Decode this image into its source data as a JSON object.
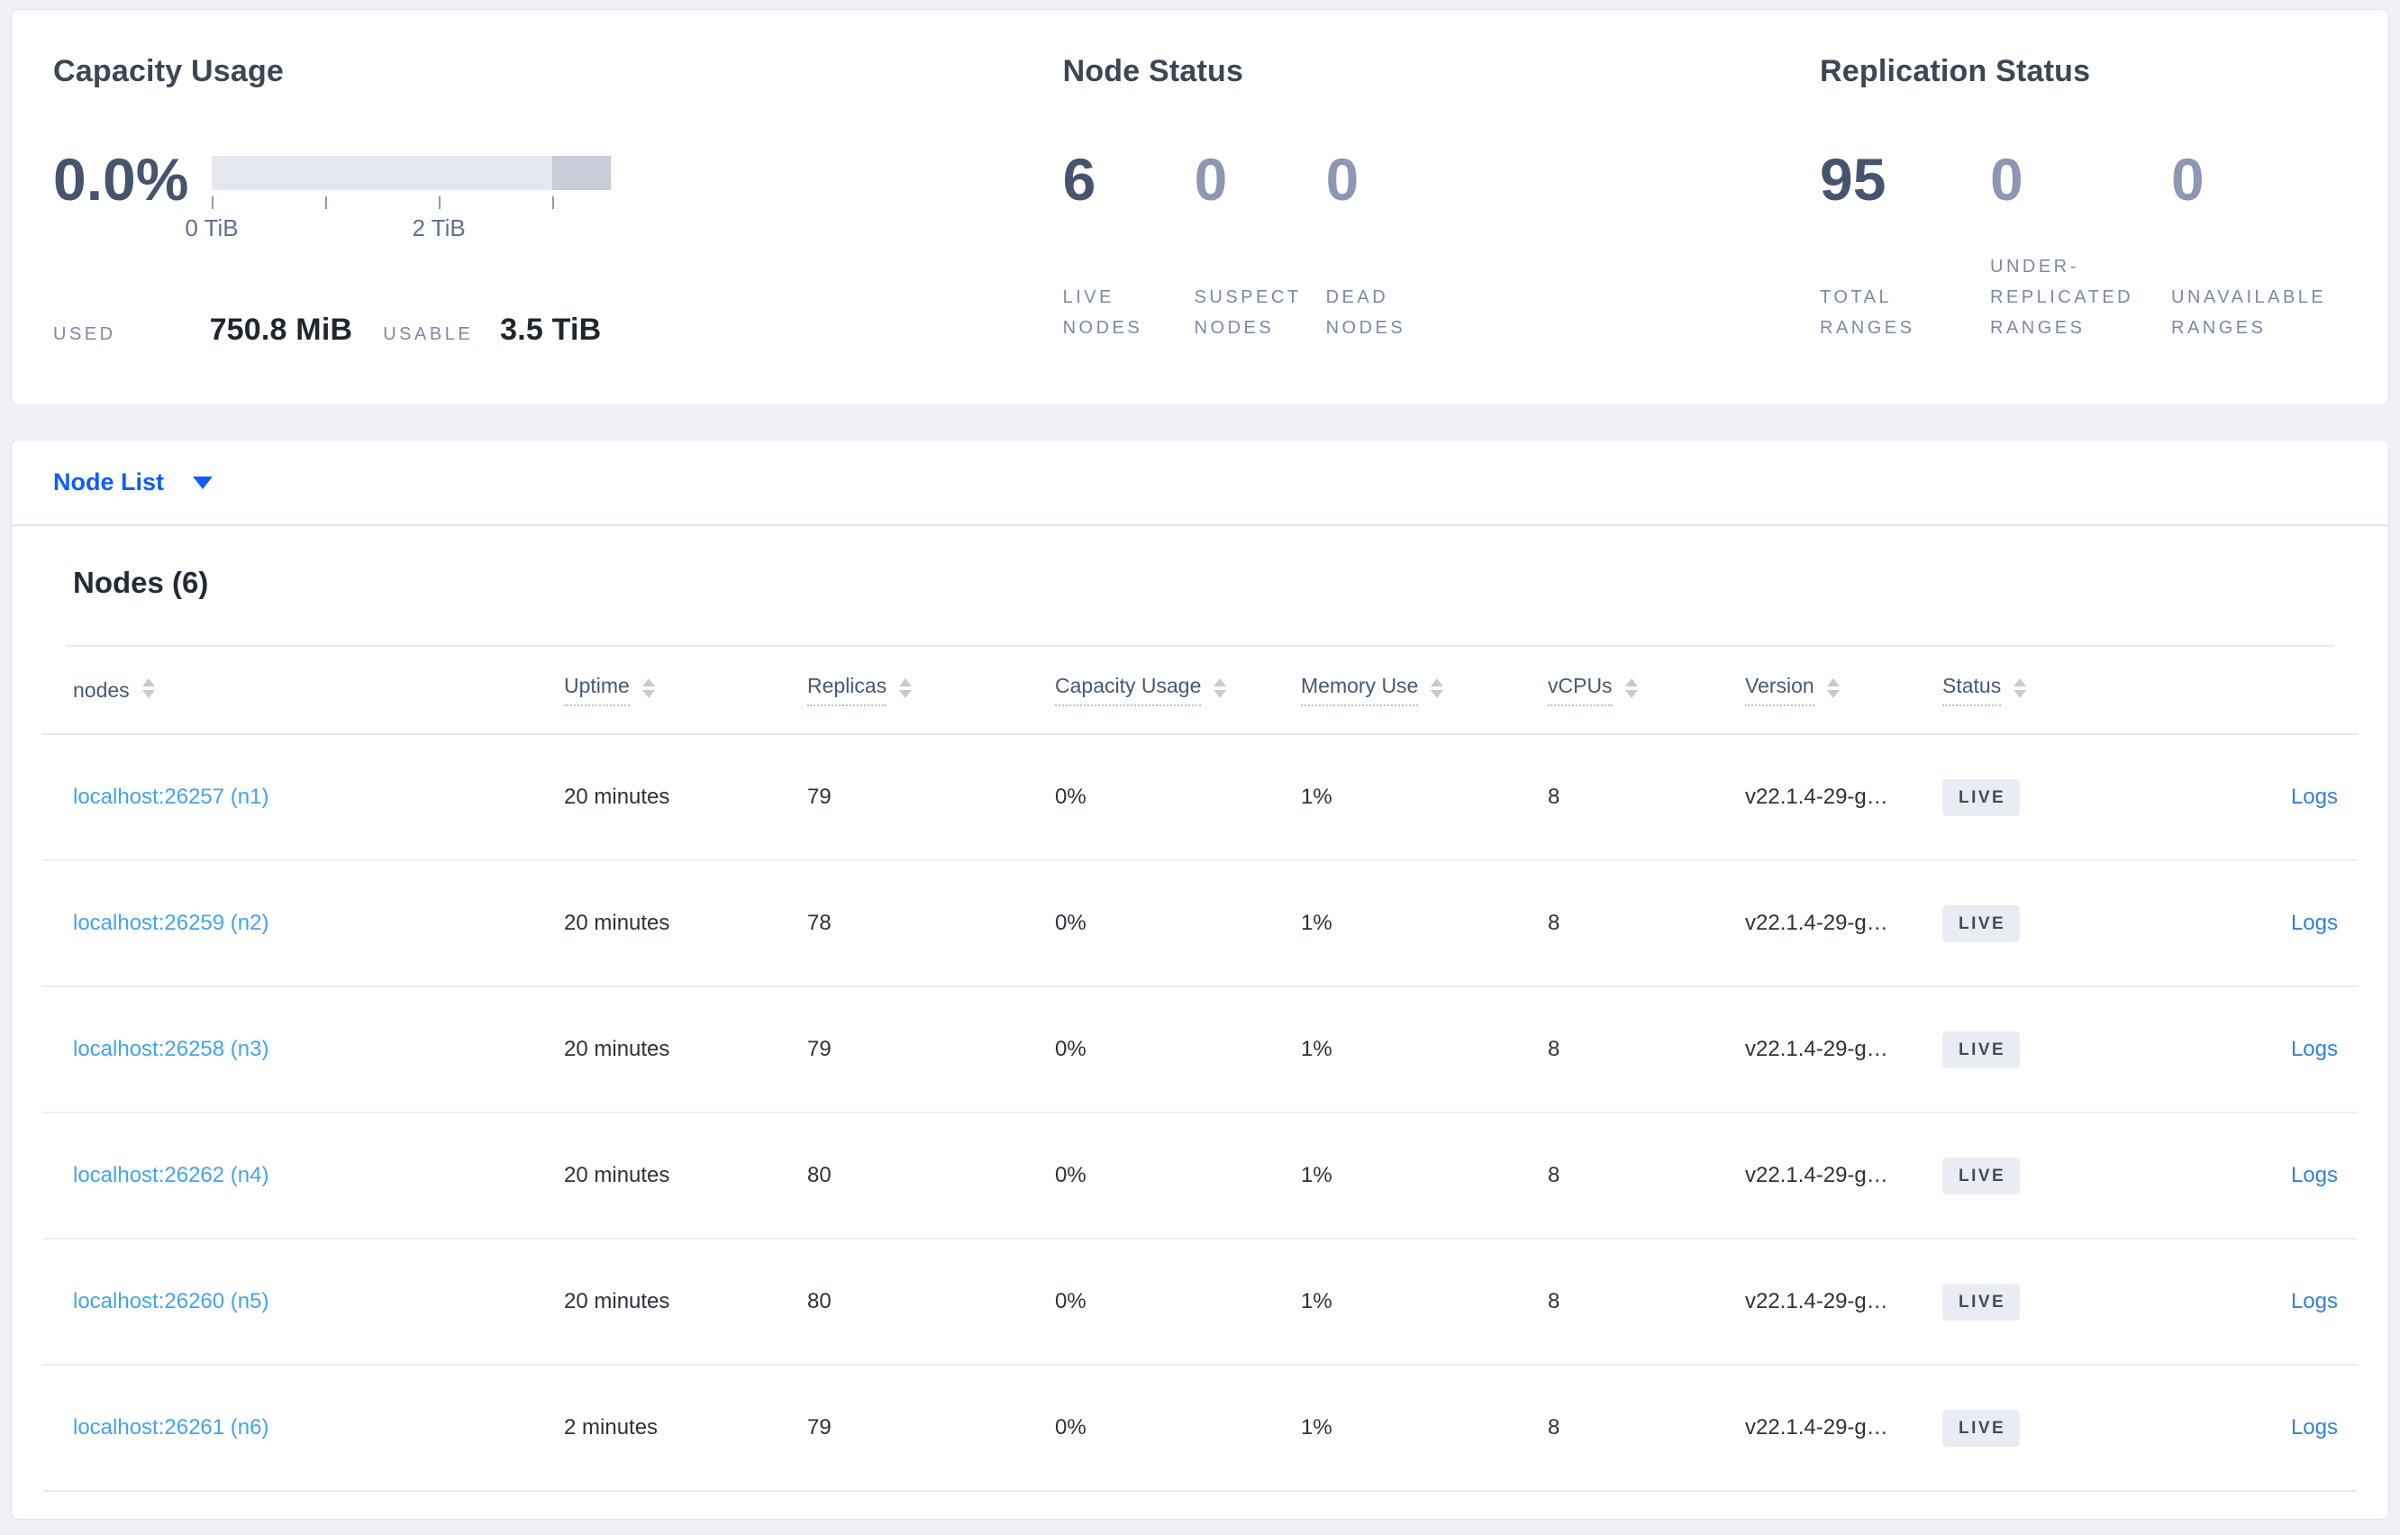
{
  "summary": {
    "capacity": {
      "title": "Capacity Usage",
      "percent": "0.0%",
      "used_label": "USED",
      "used_value": "750.8 MiB",
      "usable_label": "USABLE",
      "usable_value": "3.5 TiB",
      "gauge": {
        "fill_pct": 0,
        "provisioned_split_pct": 85.3,
        "ticks": [
          {
            "pos_pct": 0,
            "label": "0 TiB"
          },
          {
            "pos_pct": 28.4,
            "label": ""
          },
          {
            "pos_pct": 56.9,
            "label": "2 TiB"
          },
          {
            "pos_pct": 85.3,
            "label": ""
          }
        ]
      }
    },
    "node_status": {
      "title": "Node Status",
      "stats": [
        {
          "value": "6",
          "label": "LIVE NODES",
          "emphasis": "strong"
        },
        {
          "value": "0",
          "label": "SUSPECT NODES",
          "emphasis": "muted"
        },
        {
          "value": "0",
          "label": "DEAD NODES",
          "emphasis": "muted"
        }
      ]
    },
    "replication": {
      "title": "Replication Status",
      "stats": [
        {
          "value": "95",
          "label": "TOTAL RANGES",
          "emphasis": "strong"
        },
        {
          "value": "0",
          "label": "UNDER-REPLICATED RANGES",
          "emphasis": "muted"
        },
        {
          "value": "0",
          "label": "UNAVAILABLE RANGES",
          "emphasis": "muted"
        }
      ]
    }
  },
  "node_list_dropdown": {
    "label": "Node List"
  },
  "nodes_table": {
    "title": "Nodes (6)",
    "columns": [
      {
        "label": "nodes",
        "sortable": false
      },
      {
        "label": "Uptime",
        "sortable": true
      },
      {
        "label": "Replicas",
        "sortable": true
      },
      {
        "label": "Capacity Usage",
        "sortable": true
      },
      {
        "label": "Memory Use",
        "sortable": true
      },
      {
        "label": "vCPUs",
        "sortable": true
      },
      {
        "label": "Version",
        "sortable": true
      },
      {
        "label": "Status",
        "sortable": true
      }
    ],
    "rows": [
      {
        "address": "localhost:26257 (n1)",
        "uptime": "20 minutes",
        "replicas": "79",
        "capacity_usage": "0%",
        "memory_use": "1%",
        "vcpus": "8",
        "version": "v22.1.4-29-g…",
        "status": "LIVE",
        "logs": "Logs"
      },
      {
        "address": "localhost:26259 (n2)",
        "uptime": "20 minutes",
        "replicas": "78",
        "capacity_usage": "0%",
        "memory_use": "1%",
        "vcpus": "8",
        "version": "v22.1.4-29-g…",
        "status": "LIVE",
        "logs": "Logs"
      },
      {
        "address": "localhost:26258 (n3)",
        "uptime": "20 minutes",
        "replicas": "79",
        "capacity_usage": "0%",
        "memory_use": "1%",
        "vcpus": "8",
        "version": "v22.1.4-29-g…",
        "status": "LIVE",
        "logs": "Logs"
      },
      {
        "address": "localhost:26262 (n4)",
        "uptime": "20 minutes",
        "replicas": "80",
        "capacity_usage": "0%",
        "memory_use": "1%",
        "vcpus": "8",
        "version": "v22.1.4-29-g…",
        "status": "LIVE",
        "logs": "Logs"
      },
      {
        "address": "localhost:26260 (n5)",
        "uptime": "20 minutes",
        "replicas": "80",
        "capacity_usage": "0%",
        "memory_use": "1%",
        "vcpus": "8",
        "version": "v22.1.4-29-g…",
        "status": "LIVE",
        "logs": "Logs"
      },
      {
        "address": "localhost:26261 (n6)",
        "uptime": "2 minutes",
        "replicas": "79",
        "capacity_usage": "0%",
        "memory_use": "1%",
        "vcpus": "8",
        "version": "v22.1.4-29-g…",
        "status": "LIVE",
        "logs": "Logs"
      }
    ]
  },
  "colors": {
    "accent_blue": "#0b5dff",
    "node_link_blue": "#40a3f5",
    "logs_link_blue": "#2f80e8",
    "live_badge_bg": "#e9ecf2",
    "stat_strong": "#46546e",
    "stat_muted": "#8d97b4",
    "gauge_light": "#e6e8f0",
    "gauge_dark": "#c9cdd9"
  }
}
